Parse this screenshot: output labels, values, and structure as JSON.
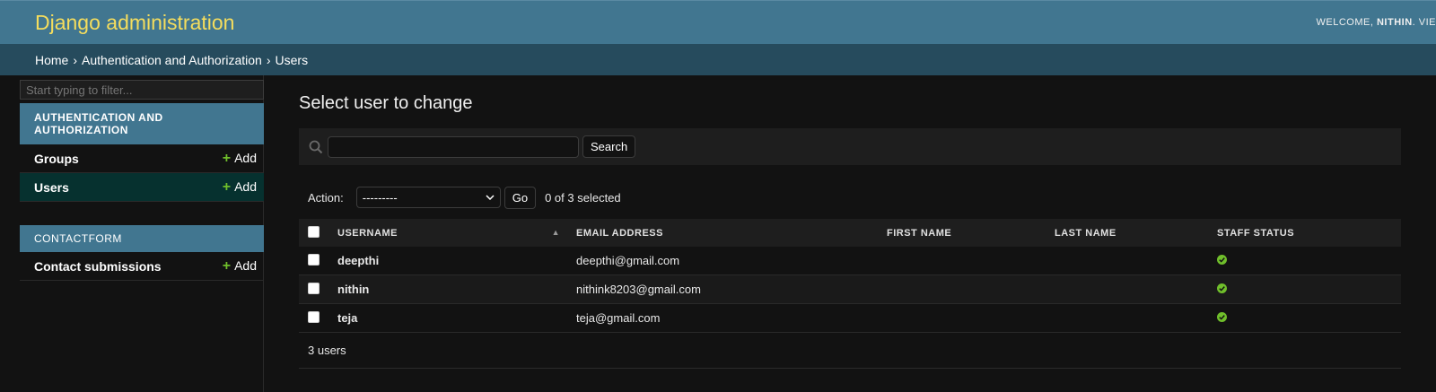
{
  "header": {
    "site_title": "Django administration",
    "welcome": "WELCOME,",
    "username": "NITHIN",
    "view_site": ". VIE"
  },
  "breadcrumbs": {
    "home": "Home",
    "app": "Authentication and Authorization",
    "current": "Users"
  },
  "sidebar": {
    "filter_placeholder": "Start typing to filter...",
    "apps": [
      {
        "caption": "AUTHENTICATION AND AUTHORIZATION",
        "models": [
          {
            "name": "Groups",
            "add": "Add"
          },
          {
            "name": "Users",
            "add": "Add"
          }
        ]
      },
      {
        "caption": "CONTACTFORM",
        "models": [
          {
            "name": "Contact submissions",
            "add": "Add"
          }
        ]
      }
    ]
  },
  "content": {
    "title": "Select user to change",
    "search": {
      "value": "",
      "button": "Search"
    },
    "actions": {
      "label": "Action:",
      "selected_option": "---------",
      "go": "Go",
      "counter": "0 of 3 selected"
    },
    "table": {
      "columns": [
        "USERNAME",
        "EMAIL ADDRESS",
        "FIRST NAME",
        "LAST NAME",
        "STAFF STATUS"
      ],
      "rows": [
        {
          "username": "deepthi",
          "email": "deepthi@gmail.com",
          "first_name": "",
          "last_name": "",
          "staff": true
        },
        {
          "username": "nithin",
          "email": "nithink8203@gmail.com",
          "first_name": "",
          "last_name": "",
          "staff": true
        },
        {
          "username": "teja",
          "email": "teja@gmail.com",
          "first_name": "",
          "last_name": "",
          "staff": true
        }
      ]
    },
    "paginator": "3 users"
  },
  "colors": {
    "header_bg": "#417690",
    "breadcrumb_bg": "#264b5d",
    "branding": "#f5dd5d",
    "add_plus": "#70bf2b",
    "current_model_bg": "#06312f",
    "check_green": "#70bf2b"
  }
}
